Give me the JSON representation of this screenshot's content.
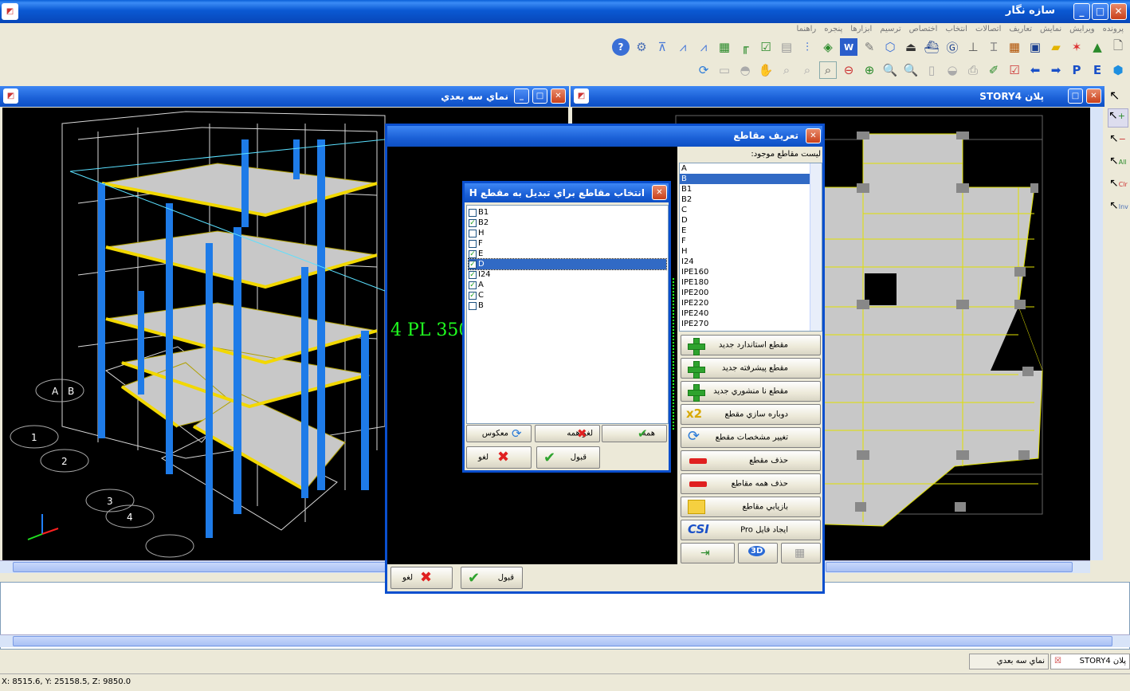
{
  "app": {
    "title": "سازه نگار"
  },
  "menu": [
    "پرونده",
    "ويرايش",
    "نمايش",
    "تعاريف",
    "اتصالات",
    "انتخاب",
    "اختصاص",
    "ترسيم",
    "ابزارها",
    "پنجره",
    "راهنما"
  ],
  "window_3d": {
    "title": "نماي سه بعدي"
  },
  "window_plan": {
    "title": "پلان  STORY4"
  },
  "canvas_label": "4 PL 350",
  "grid_labels": [
    "1",
    "2",
    "3",
    "4",
    "A",
    "B"
  ],
  "sections_dialog": {
    "title": "تعريف مقاطع",
    "list_label": "ليست مقاطع موجود:",
    "list_items": [
      "A",
      "B",
      "B1",
      "B2",
      "C",
      "D",
      "E",
      "F",
      "H",
      "I24",
      "IPE160",
      "IPE180",
      "IPE200",
      "IPE220",
      "IPE240",
      "IPE270"
    ],
    "selected_item": "B",
    "buttons": [
      {
        "label": "مقطع استاندارد جديد",
        "icon": "plus-icon"
      },
      {
        "label": "مقطع پيشرفته جديد",
        "icon": "plus-icon"
      },
      {
        "label": "مقطع نا منشوري جديد",
        "icon": "plus-icon"
      },
      {
        "label": "دوباره سازي مقطع",
        "icon": "x2-icon"
      },
      {
        "label": "تغيير مشخصات مقطع",
        "icon": "refresh-icon"
      },
      {
        "label": "حذف مقطع",
        "icon": "red-bar-icon"
      },
      {
        "label": "حذف همه مقاطع",
        "icon": "red-bar-icon"
      },
      {
        "label": "بازيابي مقاطع",
        "icon": "folder-icon"
      },
      {
        "label": "ايجاد فايل Pro",
        "icon": "csi-icon"
      }
    ],
    "ok_label": "قبول",
    "cancel_label": "لغو"
  },
  "select_dialog": {
    "title": "انتخاب مقاطع براي تبديل به مقطع H",
    "items": [
      {
        "label": "B1",
        "checked": false
      },
      {
        "label": "B2",
        "checked": true
      },
      {
        "label": "H",
        "checked": false
      },
      {
        "label": "F",
        "checked": false
      },
      {
        "label": "E",
        "checked": true
      },
      {
        "label": "D",
        "checked": true
      },
      {
        "label": "I24",
        "checked": true
      },
      {
        "label": "A",
        "checked": true
      },
      {
        "label": "C",
        "checked": true
      },
      {
        "label": "B",
        "checked": false
      }
    ],
    "highlighted": "D",
    "all_label": "همه",
    "none_label": "لغو همه",
    "invert_label": "معكوس",
    "ok_label": "قبول",
    "cancel_label": "لغو"
  },
  "taskbar": [
    {
      "label": "پلان  STORY4"
    },
    {
      "label": "نماي سه بعدي"
    }
  ],
  "status": {
    "coords": "X: 8515.6, Y: 25158.5, Z: 9850.0"
  },
  "side_tools": [
    "All",
    "Clr",
    "Inv"
  ]
}
